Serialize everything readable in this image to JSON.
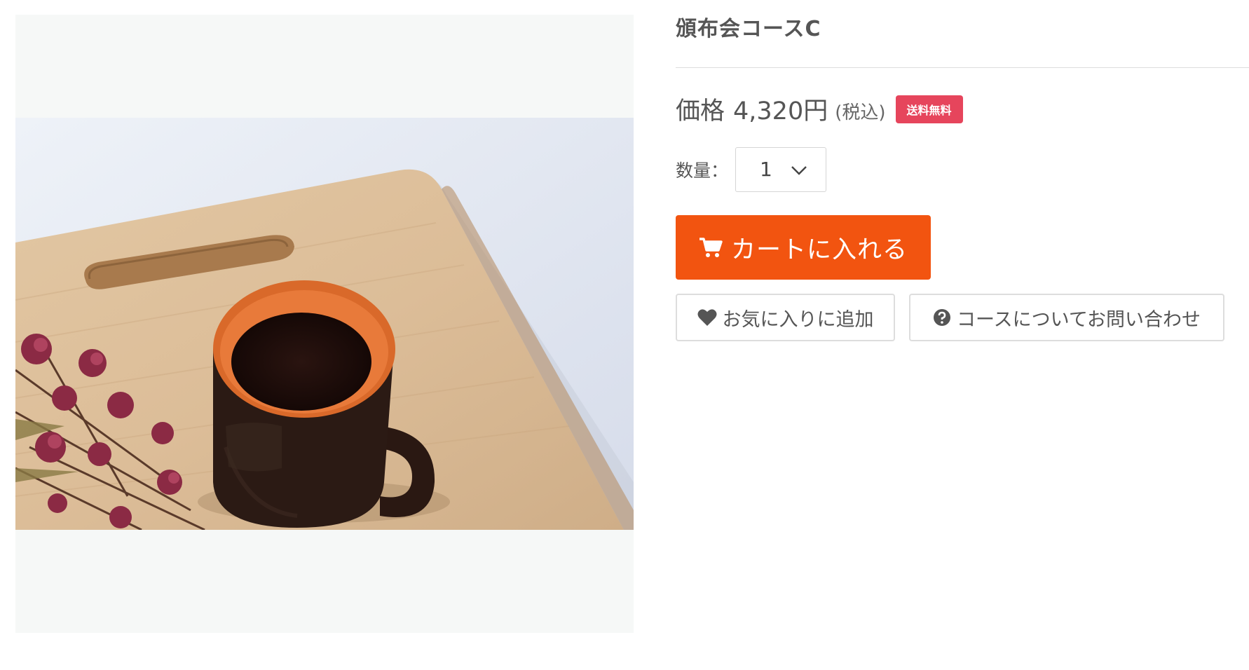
{
  "product": {
    "title": "頒布会コースC",
    "price_label": "価格",
    "price_value": "4,320円",
    "tax_note": "(税込)",
    "shipping_badge": "送料無料",
    "quantity_label": "数量：",
    "quantity_value": "1",
    "cart_button_label": "カートに入れる",
    "favorite_button_label": "お気に入りに追加",
    "inquiry_button_label": "コースについてお問い合わせ"
  },
  "icons": {
    "cart": "cart-icon",
    "favorite": "heart-icon",
    "inquiry": "question-circle-icon",
    "quantity_dropdown": "chevron-down-icon"
  },
  "colors": {
    "cart_button": "#f25410",
    "shipping_badge": "#e6455c",
    "text": "#555555",
    "image_background": "#f6f8f7"
  }
}
